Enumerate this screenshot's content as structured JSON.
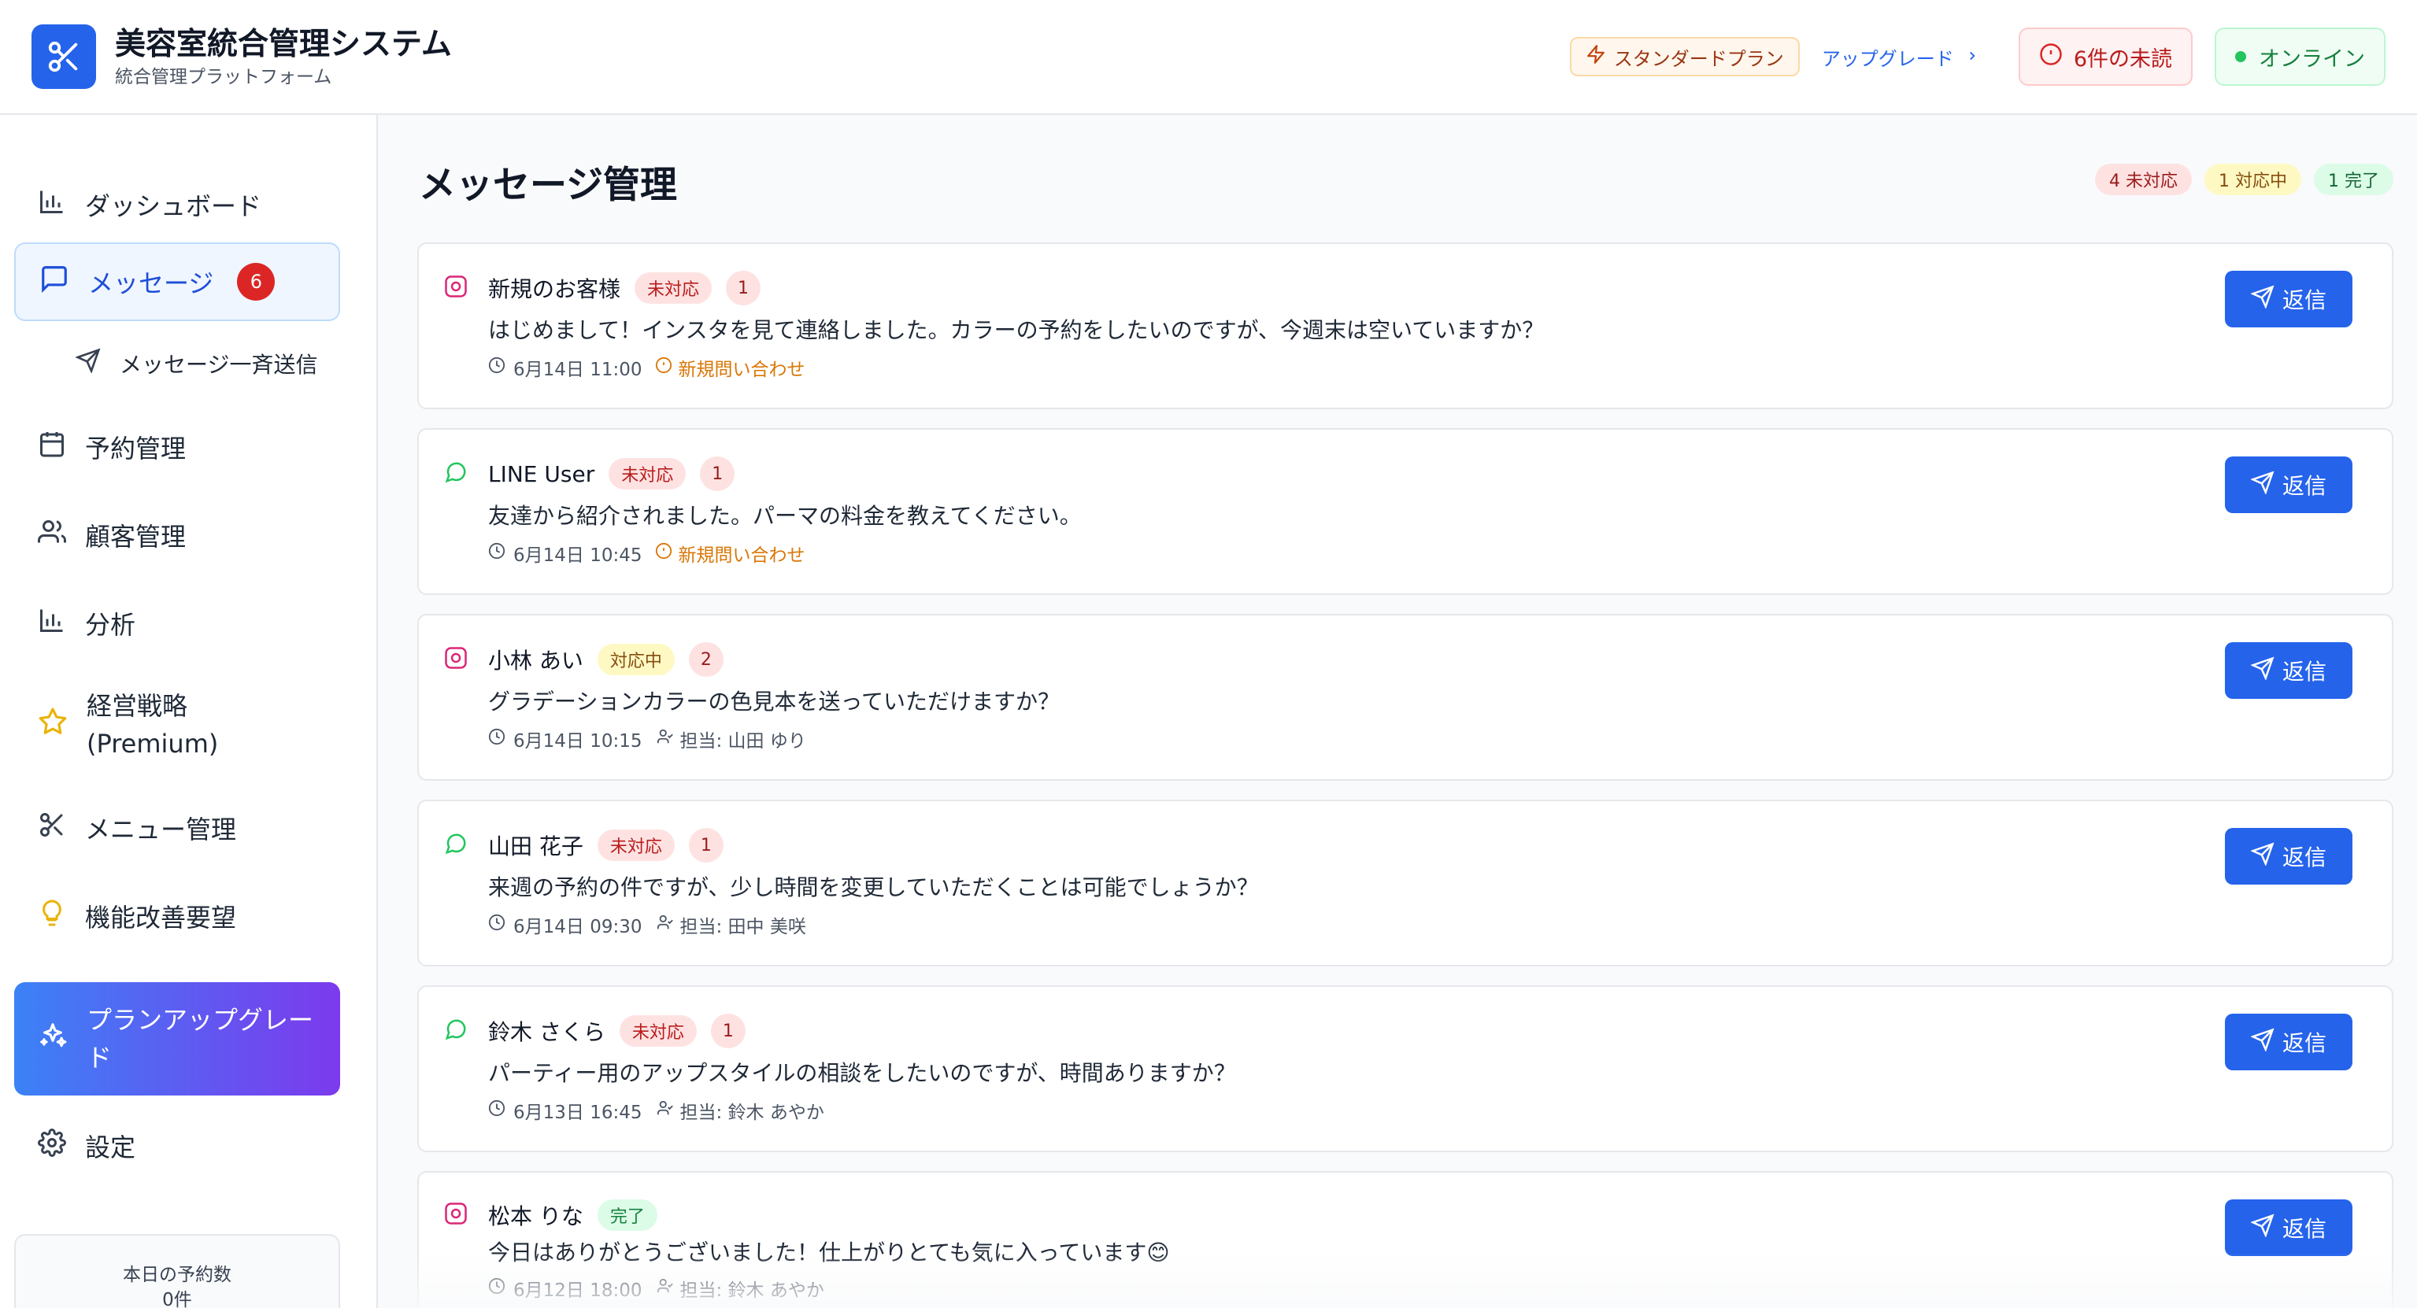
{
  "header": {
    "app_title": "美容室統合管理システム",
    "app_subtitle": "統合管理プラットフォーム",
    "plan_label": "スタンダードプラン",
    "upgrade_label": "アップグレード",
    "unread_label": "6件の未読",
    "online_label": "オンライン"
  },
  "sidebar": {
    "items": [
      {
        "label": "ダッシュボード",
        "icon": "bar-chart-icon"
      },
      {
        "label": "メッセージ",
        "icon": "message-icon",
        "badge": "6"
      },
      {
        "label": "メッセージ一斉送信",
        "icon": "send-icon"
      },
      {
        "label": "予約管理",
        "icon": "calendar-icon"
      },
      {
        "label": "顧客管理",
        "icon": "users-icon"
      },
      {
        "label": "分析",
        "icon": "bar-chart-icon"
      },
      {
        "label": "経営戦略",
        "label2": "(Premium)",
        "icon": "star-icon"
      },
      {
        "label": "メニュー管理",
        "icon": "scissors-icon"
      },
      {
        "label": "機能改善要望",
        "icon": "lightbulb-icon"
      },
      {
        "label": "プランアップグレー",
        "label2": "ド",
        "icon": "sparkles-icon"
      },
      {
        "label": "設定",
        "icon": "gear-icon"
      }
    ],
    "stats": {
      "label": "本日の予約数",
      "value": "0件"
    }
  },
  "main": {
    "title": "メッセージ管理",
    "summary": {
      "pending": "4 未対応",
      "in_progress": "1 対応中",
      "done": "1 完了"
    },
    "reply_label": "返信",
    "messages": [
      {
        "channel": "instagram",
        "name": "新規のお客様",
        "status": "未対応",
        "count": "1",
        "body": "はじめまして！インスタを見て連絡しました。カラーの予約をしたいのですが、今週末は空いていますか？",
        "time": "6月14日 11:00",
        "extra": "新規問い合わせ"
      },
      {
        "channel": "line",
        "name": "LINE User",
        "status": "未対応",
        "count": "1",
        "body": "友達から紹介されました。パーマの料金を教えてください。",
        "time": "6月14日 10:45",
        "extra": "新規問い合わせ"
      },
      {
        "channel": "instagram",
        "name": "小林 あい",
        "status": "対応中",
        "count": "2",
        "body": "グラデーションカラーの色見本を送っていただけますか？",
        "time": "6月14日 10:15",
        "extra": "担当: 山田 ゆり"
      },
      {
        "channel": "line",
        "name": "山田 花子",
        "status": "未対応",
        "count": "1",
        "body": "来週の予約の件ですが、少し時間を変更していただくことは可能でしょうか？",
        "time": "6月14日 09:30",
        "extra": "担当: 田中 美咲"
      },
      {
        "channel": "line",
        "name": "鈴木 さくら",
        "status": "未対応",
        "count": "1",
        "body": "パーティー用のアップスタイルの相談をしたいのですが、時間ありますか？",
        "time": "6月13日 16:45",
        "extra": "担当: 鈴木 あやか"
      },
      {
        "channel": "instagram",
        "name": "松本 りな",
        "status": "完了",
        "count": "",
        "body": "今日はありがとうございました！仕上がりとても気に入っています😊",
        "time": "6月12日 18:00",
        "extra": "担当: 鈴木 あやか"
      }
    ]
  },
  "colors": {
    "accent": "#2563eb",
    "danger": "#dc2626",
    "success": "#22c55e",
    "warning": "#d97706"
  }
}
